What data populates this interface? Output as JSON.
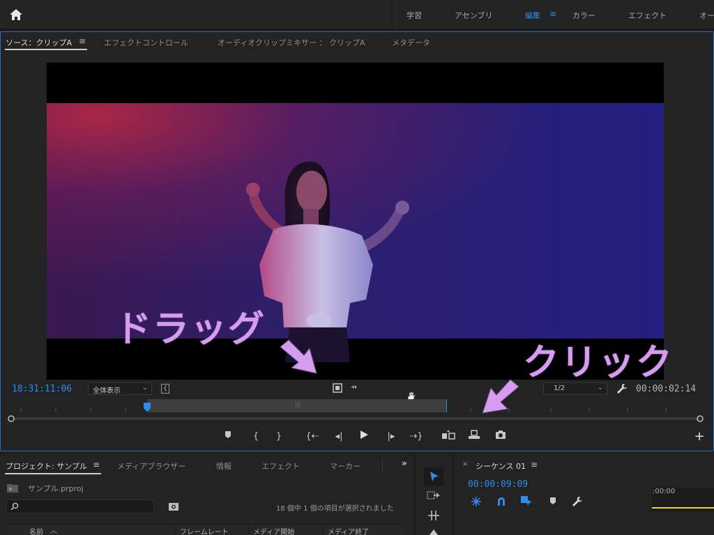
{
  "workspaces": {
    "items": [
      "学習",
      "アセンブリ",
      "編集",
      "カラー",
      "エフェクト",
      "オー"
    ],
    "active": "編集"
  },
  "source_panel": {
    "tabs": [
      "ソース：クリップA",
      "エフェクトコントロール",
      "オーディオクリップミキサー ： クリップA",
      "メタデータ"
    ],
    "timecode_in": "18:31:11:06",
    "fit_label": "全体表示",
    "resolution_label": "1/2",
    "timecode_duration": "00:00:02:14"
  },
  "annotations": {
    "drag": "ドラッグ",
    "click": "クリック"
  },
  "project_panel": {
    "tabs": [
      "プロジェクト: サンプル",
      "メディアブラウザー",
      "情報",
      "エフェクト",
      "マーカー"
    ],
    "file_name": "サンプル.prproj",
    "selection_status": "18 個中 1 個の項目が選択されました",
    "columns": [
      "名前",
      "フレームレート",
      "メディア開始",
      "メディア終了"
    ]
  },
  "timeline_panel": {
    "title": "シーケンス 01",
    "timecode": "00:00:09:09",
    "ruler_label": ":00:00"
  },
  "colors": {
    "accent": "#2d8ceb",
    "annotation": "#d69cf0",
    "panel_bg": "#232323"
  }
}
